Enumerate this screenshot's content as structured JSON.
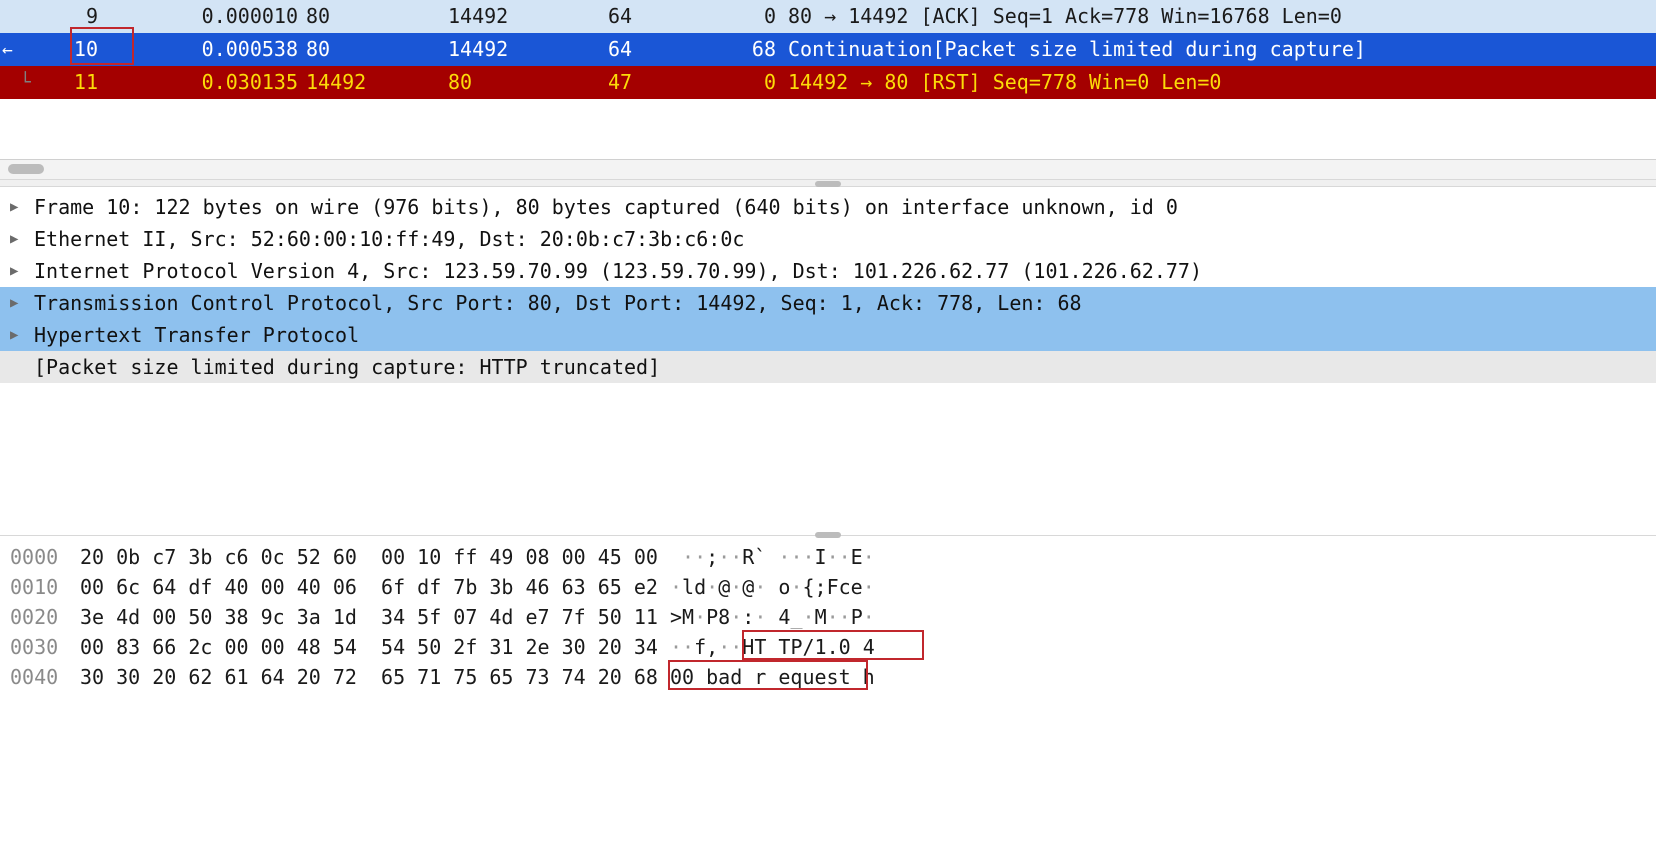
{
  "packet_list": {
    "rows": [
      {
        "no": "9",
        "time": "0.000010",
        "src": "80",
        "dst": "14492",
        "len": "64",
        "len2": "0",
        "info": "80 → 14492 [ACK] Seq=1 Ack=778 Win=16768 Len=0",
        "style": "row-bg-lightblue",
        "boxed": false,
        "arrow": false,
        "corner": ""
      },
      {
        "no": "10",
        "time": "0.000538",
        "src": "80",
        "dst": "14492",
        "len": "64",
        "len2": "68",
        "info": "Continuation[Packet size limited during capture]",
        "style": "row-bg-blue",
        "boxed": true,
        "arrow": true,
        "corner": ""
      },
      {
        "no": "11",
        "time": "0.030135",
        "src": "14492",
        "dst": "80",
        "len": "47",
        "len2": "0",
        "info": "14492 → 80 [RST] Seq=778 Win=0 Len=0",
        "style": "row-bg-red",
        "boxed": false,
        "arrow": false,
        "corner": "└"
      }
    ]
  },
  "detail_pane": {
    "rows": [
      {
        "text": "Frame 10: 122 bytes on wire (976 bits), 80 bytes captured (640 bits) on interface unknown, id 0",
        "expandable": true,
        "selected": false,
        "gray": false
      },
      {
        "text": "Ethernet II, Src: 52:60:00:10:ff:49, Dst: 20:0b:c7:3b:c6:0c",
        "expandable": true,
        "selected": false,
        "gray": false
      },
      {
        "text": "Internet Protocol Version 4, Src: 123.59.70.99 (123.59.70.99), Dst: 101.226.62.77 (101.226.62.77)",
        "expandable": true,
        "selected": false,
        "gray": false
      },
      {
        "text": "Transmission Control Protocol, Src Port: 80, Dst Port: 14492, Seq: 1, Ack: 778, Len: 68",
        "expandable": true,
        "selected": true,
        "gray": false
      },
      {
        "text": "Hypertext Transfer Protocol",
        "expandable": true,
        "selected": true,
        "gray": false
      },
      {
        "text": "[Packet size limited during capture: HTTP truncated]",
        "expandable": false,
        "selected": false,
        "gray": true
      }
    ]
  },
  "hex_pane": {
    "rows": [
      {
        "offset": "0000",
        "bytes1": "20 0b c7 3b c6 0c 52 60",
        "bytes2": "00 10 ff 49 08 00 45 00",
        "ascii_parts": [
          [
            "g",
            " ··"
          ],
          [
            "p",
            ";"
          ],
          [
            "g",
            "··"
          ],
          [
            "p",
            "R`"
          ],
          [
            "g",
            " ···"
          ],
          [
            "p",
            "I"
          ],
          [
            "g",
            "··"
          ],
          [
            "p",
            "E"
          ],
          [
            "g",
            "·"
          ]
        ]
      },
      {
        "offset": "0010",
        "bytes1": "00 6c 64 df 40 00 40 06",
        "bytes2": "6f df 7b 3b 46 63 65 e2",
        "ascii_parts": [
          [
            "g",
            "·"
          ],
          [
            "p",
            "ld"
          ],
          [
            "g",
            "·"
          ],
          [
            "p",
            "@"
          ],
          [
            "g",
            "·"
          ],
          [
            "p",
            "@"
          ],
          [
            "g",
            "·"
          ],
          [
            "p",
            " o"
          ],
          [
            "g",
            "·"
          ],
          [
            "p",
            "{;Fce"
          ],
          [
            "g",
            "·"
          ]
        ]
      },
      {
        "offset": "0020",
        "bytes1": "3e 4d 00 50 38 9c 3a 1d",
        "bytes2": "34 5f 07 4d e7 7f 50 11",
        "ascii_parts": [
          [
            "p",
            ">M"
          ],
          [
            "g",
            "·"
          ],
          [
            "p",
            "P8"
          ],
          [
            "g",
            "·"
          ],
          [
            "p",
            ":"
          ],
          [
            "g",
            "·"
          ],
          [
            "p",
            " 4"
          ],
          [
            "g",
            "_·"
          ],
          [
            "p",
            "M"
          ],
          [
            "g",
            "··"
          ],
          [
            "p",
            "P"
          ],
          [
            "g",
            "·"
          ]
        ]
      },
      {
        "offset": "0030",
        "bytes1": "00 83 66 2c 00 00 48 54",
        "bytes2": "54 50 2f 31 2e 30 20 34",
        "ascii_parts": [
          [
            "g",
            "··"
          ],
          [
            "p",
            "f,"
          ],
          [
            "g",
            "··"
          ],
          [
            "p",
            "HT TP/1.0 4"
          ]
        ]
      },
      {
        "offset": "0040",
        "bytes1": "30 30 20 62 61 64 20 72",
        "bytes2": "65 71 75 65 73 74 20 68",
        "ascii_parts": [
          [
            "p",
            "00 bad r equest h"
          ]
        ]
      }
    ]
  },
  "annotations": {
    "hex_box1": "HT TP/1.0 4",
    "hex_box2": "00 bad r equest"
  }
}
